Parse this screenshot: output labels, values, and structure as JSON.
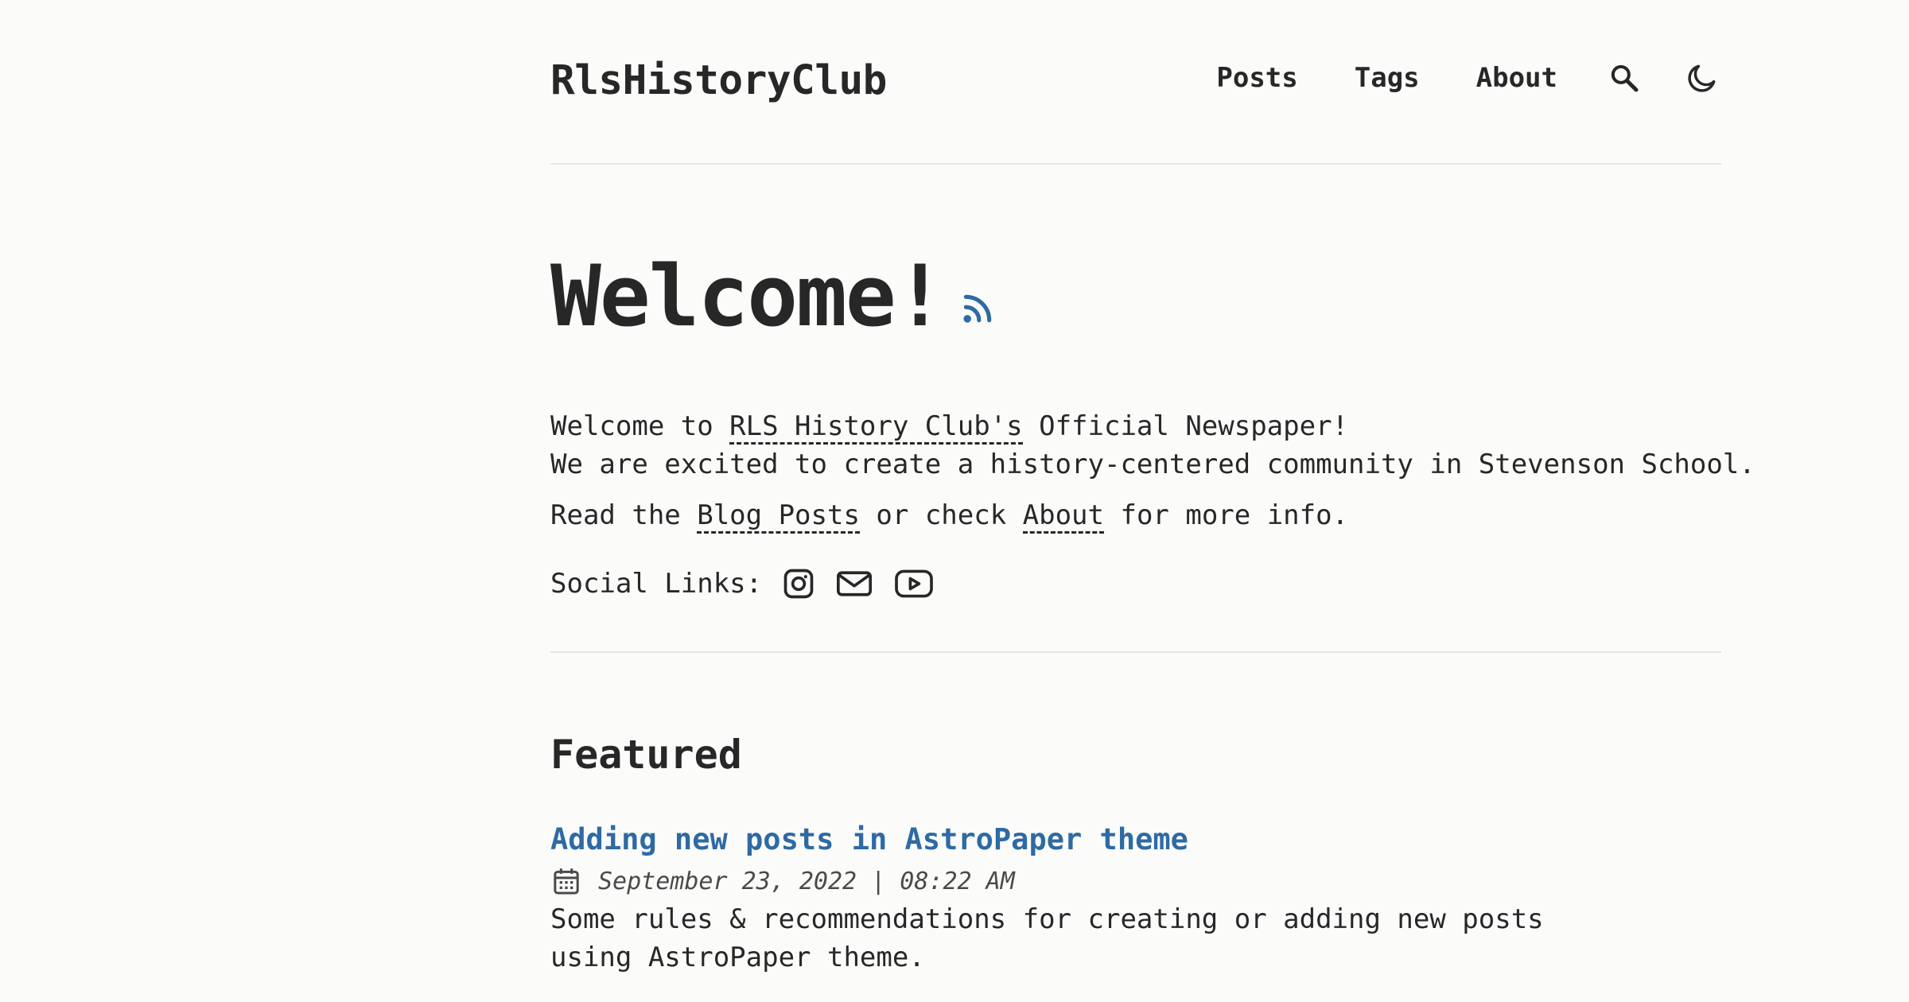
{
  "header": {
    "logo": "RlsHistoryClub",
    "nav": [
      "Posts",
      "Tags",
      "About"
    ],
    "search_icon": "search-icon",
    "theme_icon": "moon-icon"
  },
  "hero": {
    "title": "Welcome!",
    "rss_icon": "rss-icon",
    "line1_prefix": "Welcome to ",
    "line1_link": "RLS History Club's",
    "line1_suffix": " Official Newspaper!",
    "line2": "We are excited to create a history-centered community in Stevenson School.",
    "line3_prefix": "Read the ",
    "line3_link1": "Blog Posts",
    "line3_mid": " or check ",
    "line3_link2": "About",
    "line3_suffix": " for more info.",
    "social_label": "Social Links:",
    "social_icons": [
      "instagram-icon",
      "mail-icon",
      "youtube-icon"
    ]
  },
  "featured": {
    "heading": "Featured",
    "posts": [
      {
        "title": "Adding new posts in AstroPaper theme",
        "date": "September 23, 2022 | 08:22 AM",
        "description": "Some rules & recommendations for creating or adding new posts using AstroPaper theme."
      }
    ]
  },
  "colors": {
    "background": "#fbfcfa",
    "text": "#282728",
    "accent": "#2e6aa4"
  }
}
